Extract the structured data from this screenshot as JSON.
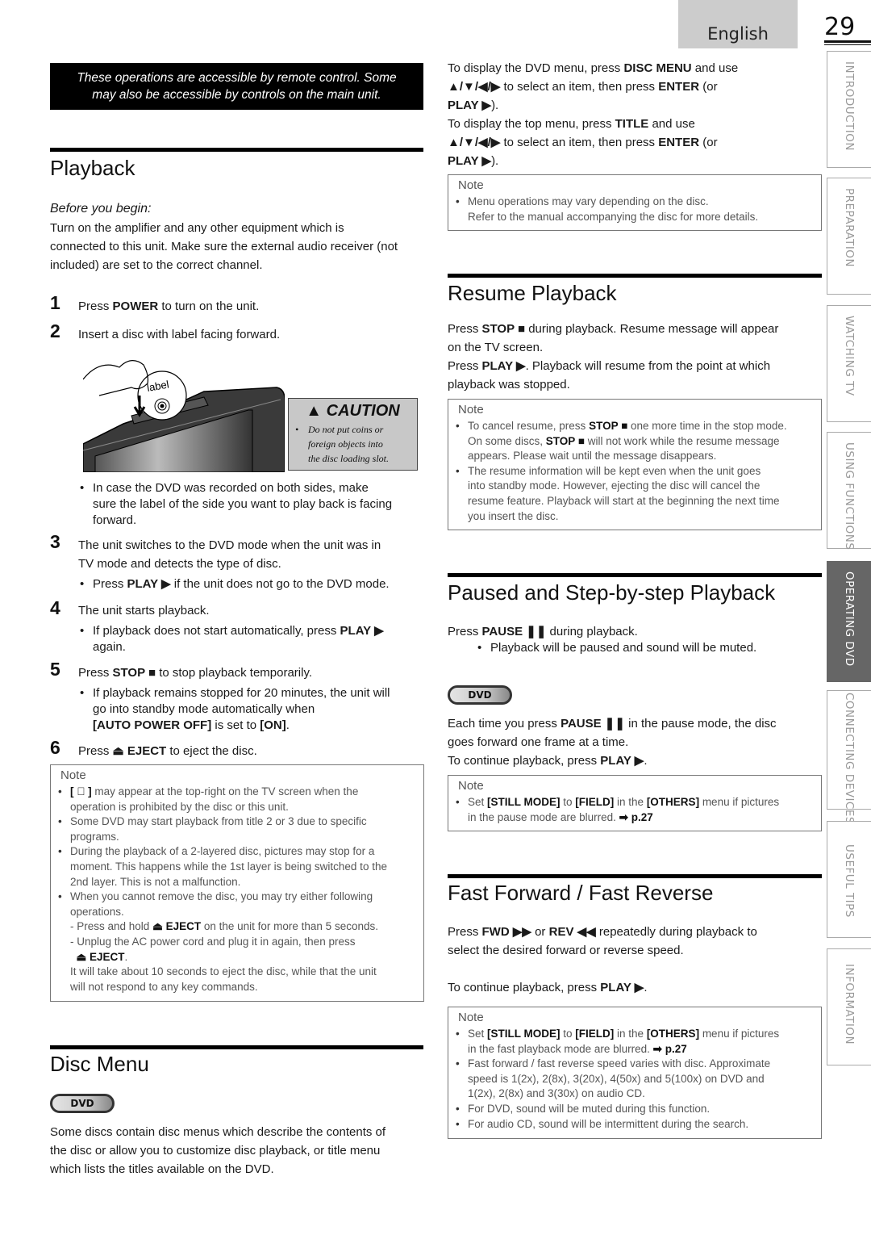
{
  "header": {
    "language": "English",
    "page_number": "29"
  },
  "side_tabs": [
    {
      "label": "INTRODUCTION",
      "active": false
    },
    {
      "label": "PREPARATION",
      "active": false
    },
    {
      "label": "WATCHING TV",
      "active": false
    },
    {
      "label": "USING FUNCTIONS",
      "active": false
    },
    {
      "label": "OPERATING DVD",
      "active": true
    },
    {
      "label": "CONNECTING DEVICES",
      "active": false
    },
    {
      "label": "USEFUL TIPS",
      "active": false
    },
    {
      "label": "INFORMATION",
      "active": false
    }
  ],
  "banner": {
    "line1": "These operations are accessible by remote control. Some",
    "line2": "may also be accessible by controls on the main unit."
  },
  "playback": {
    "title": "Playback",
    "before_label": "Before you begin:",
    "before_text": [
      "Turn on the amplifier and any other equipment which is",
      "connected to this unit. Make sure the external audio receiver (not",
      "included) are set to the correct channel."
    ],
    "steps": [
      {
        "num": "1",
        "pre": "Press ",
        "bold": "POWER",
        "post": " to turn on the unit."
      },
      {
        "num": "2",
        "text": "Insert a disc with label facing forward."
      },
      {
        "num": "3",
        "line1": "The unit switches to the DVD mode when the unit was in",
        "line2": "TV mode and detects the type of disc."
      },
      {
        "num": "4",
        "text": "The unit starts playback."
      },
      {
        "num": "5",
        "pre": "Press ",
        "bold": "STOP ■",
        "post": " to stop playback temporarily."
      },
      {
        "num": "6",
        "pre": "Press ",
        "bold": "⏏ EJECT",
        "post": " to eject the disc."
      }
    ],
    "illustration_label": "label",
    "caution": {
      "title": "CAUTION",
      "text": [
        "Do not put coins or",
        "foreign objects into",
        "the disc loading slot."
      ]
    },
    "bullet_2": [
      "In case the DVD was recorded on both sides, make",
      "sure the label of the side you want to play back is facing",
      "forward."
    ],
    "bullet_3": {
      "pre": "Press ",
      "bold": "PLAY ▶",
      "post": " if the unit does not go to the DVD mode."
    },
    "bullet_4": {
      "pre": "If playback does not start automatically, press ",
      "bold": "PLAY ▶",
      "line2": "again."
    },
    "bullet_5": {
      "line1": "If playback remains stopped for 20 minutes, the unit will",
      "line2": "go into standby mode automatically when",
      "b1": "[AUTO POWER OFF]",
      "mid": " is set to ",
      "b2": "[ON]",
      "end": "."
    },
    "note": {
      "title": "Note",
      "items": [
        {
          "bold": "[ ⃠ ]",
          "line1": " may appear at the top-right on the TV screen when the",
          "line2": "operation is prohibited by the disc or this unit."
        },
        {
          "line1": "Some DVD may start playback from title 2 or 3 due to specific",
          "line2": "programs."
        },
        {
          "line1": "During the playback of a 2-layered disc, pictures may stop for a",
          "line2": "moment. This happens while the 1st layer is being switched to the",
          "line3": "2nd layer. This is not a malfunction."
        },
        {
          "line1": "When you cannot remove the disc, you may try either following",
          "line2": "operations."
        }
      ],
      "sub1": {
        "pre": "- Press and hold ",
        "bold": "⏏ EJECT",
        "post": " on the unit for more than 5 seconds."
      },
      "sub2": {
        "line1": "- Unplug the AC power cord and plug it in again, then press",
        "bold": "⏏ EJECT",
        "end": "."
      },
      "tail": [
        "It will take about 10 seconds to eject the disc, while that the unit",
        "will not respond to any key commands."
      ]
    }
  },
  "disc_menu": {
    "title": "Disc Menu",
    "badge": "DVD",
    "text": [
      "Some discs contain disc menus which describe the contents of",
      "the disc or allow you to customize disc playback, or title menu",
      "which lists the titles available on the DVD."
    ],
    "p1": {
      "pre": "To display the DVD menu, press ",
      "bold": "DISC MENU",
      "post": " and use"
    },
    "p2": {
      "arrows": "▲/▼/◀/▶",
      "pre": " to select an item, then press ",
      "bold": "ENTER",
      "post": " (or"
    },
    "p3": {
      "bold": "PLAY ▶",
      "post": ")."
    },
    "p4": {
      "pre": "To display the top menu, press ",
      "bold": "TITLE",
      "post": " and use"
    },
    "note": {
      "title": "Note",
      "line1": "Menu operations may vary depending on the disc.",
      "line2": "Refer to the manual accompanying the disc for more details."
    }
  },
  "resume": {
    "title": "Resume Playback",
    "l1": {
      "pre": "Press ",
      "bold": "STOP ■",
      "post": " during playback. Resume message will appear"
    },
    "l2": "on the TV screen.",
    "l3": {
      "pre": "Press ",
      "bold": "PLAY ▶",
      "post": ". Playback will resume from the point at which"
    },
    "l4": "playback was stopped.",
    "note": {
      "title": "Note",
      "i1": {
        "pre": "To cancel resume, press ",
        "bold": "STOP ■",
        "post": " one more time in the stop mode."
      },
      "i1b": {
        "pre": "On some discs, ",
        "bold": "STOP ■",
        "post": " will not work while the resume message"
      },
      "i1c": "appears. Please wait until the message disappears.",
      "i2": [
        "The resume information will be kept even when the unit goes",
        "into standby mode. However, ejecting the disc will cancel the",
        "resume feature. Playback will start at the beginning the next time",
        "you insert the disc."
      ]
    }
  },
  "paused": {
    "title": "Paused and Step-by-step Playback",
    "l1": {
      "pre": "Press ",
      "bold": "PAUSE ❚❚",
      "post": " during playback."
    },
    "bullet": "Playback will be paused and sound will be muted.",
    "badge": "DVD",
    "l2": {
      "pre": "Each time you press ",
      "bold": "PAUSE ❚❚",
      "post": " in the pause mode, the disc"
    },
    "l3": "goes forward one frame at a time.",
    "l4": {
      "pre": "To continue playback, press ",
      "bold": "PLAY ▶",
      "post": "."
    },
    "note": {
      "title": "Note",
      "pre": "Set ",
      "b1": "[STILL MODE]",
      "m1": " to ",
      "b2": "[FIELD]",
      "m2": " in the ",
      "b3": "[OTHERS]",
      "m3": " menu if pictures",
      "line2": "in the pause mode are blurred. ",
      "arrow": "➡",
      "ref": "p.27"
    }
  },
  "fast": {
    "title": "Fast Forward / Fast Reverse",
    "l1": {
      "pre": "Press ",
      "b1": "FWD ▶▶",
      "mid": " or ",
      "b2": "REV ◀◀",
      "post": " repeatedly during playback to"
    },
    "l2": "select the desired forward or reverse speed.",
    "l3": {
      "pre": "To continue playback, press ",
      "bold": "PLAY ▶",
      "post": "."
    },
    "note": {
      "title": "Note",
      "i1": {
        "pre": "Set ",
        "b1": "[STILL MODE]",
        "m1": " to ",
        "b2": "[FIELD]",
        "m2": " in the ",
        "b3": "[OTHERS]",
        "m3": " menu if pictures",
        "line2": "in the fast playback mode are blurred. ",
        "arrow": "➡",
        "ref": "p.27"
      },
      "i2": [
        "Fast forward / fast reverse speed varies with disc. Approximate",
        "speed is 1(2x), 2(8x), 3(20x), 4(50x) and 5(100x) on DVD and",
        "1(2x), 2(8x) and 3(30x) on audio CD."
      ],
      "i3": "For DVD, sound will be muted during this function.",
      "i4": "For audio CD, sound will be intermittent during the search."
    }
  }
}
